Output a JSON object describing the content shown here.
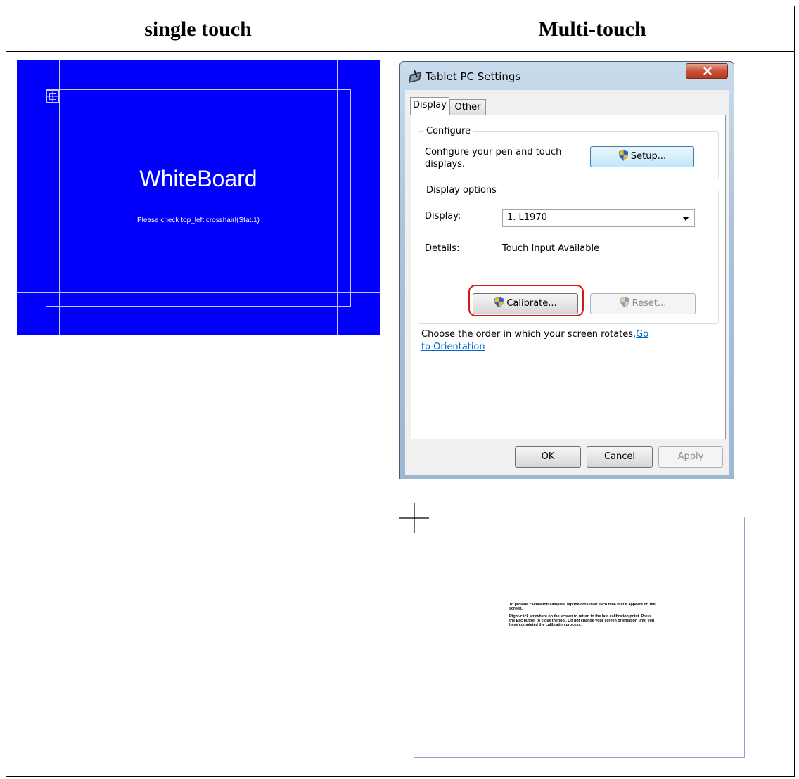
{
  "headers": {
    "single_touch": "single touch",
    "multi_touch": "Multi-touch"
  },
  "whiteboard": {
    "title": "WhiteBoard",
    "message": "Please check top_left crosshair!(Stat.1)",
    "background_color": "#0000fc"
  },
  "dialog": {
    "title": "Tablet PC Settings",
    "close_icon": "close-icon",
    "tabs": [
      {
        "label": "Display",
        "active": true
      },
      {
        "label": "Other",
        "active": false
      }
    ],
    "configure": {
      "legend": "Configure",
      "description": "Configure your pen and touch displays.",
      "setup_label": "Setup..."
    },
    "display_options": {
      "legend": "Display options",
      "display_label": "Display:",
      "display_value": "1. L1970",
      "details_label": "Details:",
      "details_value": "Touch Input Available",
      "calibrate_label": "Calibrate...",
      "reset_label": "Reset..."
    },
    "orientation": {
      "text": "Choose the order in which your screen rotates.",
      "link": "Go to Orientation"
    },
    "buttons": {
      "ok": "OK",
      "cancel": "Cancel",
      "apply": "Apply"
    },
    "highlight_color": "#d41818"
  },
  "calibration": {
    "instruction_1": "To provide calibration samples, tap the crosshair each time that it appears on the screen.",
    "instruction_2": "Right-click anywhere on the screen to return to the last calibration point. Press the Esc button to close the tool. Do not change your screen orientation until you have completed the calibration process."
  }
}
